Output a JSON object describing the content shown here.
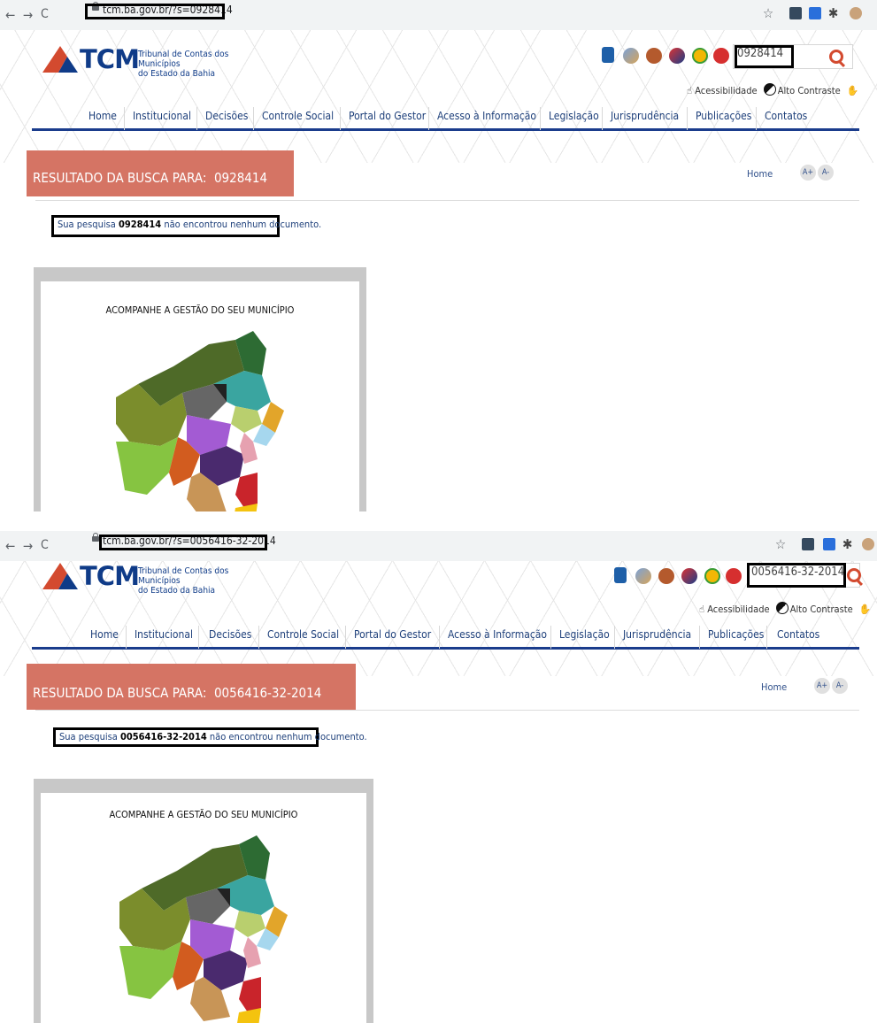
{
  "browser": {
    "url_top": "tcm.ba.gov.br/?s=0928414",
    "url_bottom": "tcm.ba.gov.br/?s=0056416-32-2014"
  },
  "logo": {
    "name": "TCM",
    "line1": "Tribunal de Contas dos Municípios",
    "line2": "do Estado da Bahia"
  },
  "accessibility": {
    "label": "Acessibilidade",
    "contrast_label": "Alto Contraste"
  },
  "menu": [
    "Home",
    "Institucional",
    "Decisões",
    "Controle Social",
    "Portal do Gestor",
    "Acesso à Informação",
    "Legislação",
    "Jurisprudência",
    "Publicações",
    "Contatos"
  ],
  "results": {
    "banner_prefix": "RESULTADO DA BUSCA PARA:",
    "breadcrumb": "Home",
    "font_increase": "A+",
    "font_decrease": "A-",
    "msg_prefix": "Sua pesquisa",
    "msg_suffix": "não encontrou nenhum documento."
  },
  "search_top": {
    "query": "0928414"
  },
  "search_bottom": {
    "query": "0056416-32-2014"
  },
  "map": {
    "title": "ACOMPANHE A GESTÃO DO SEU MUNICÍPIO"
  },
  "colors": {
    "banner": "#d57464",
    "nav_text": "#1d3f7a",
    "menu_underline": "#1a3c8c",
    "logo_blue": "#0f3b88",
    "search_icon": "#d34a2f"
  }
}
